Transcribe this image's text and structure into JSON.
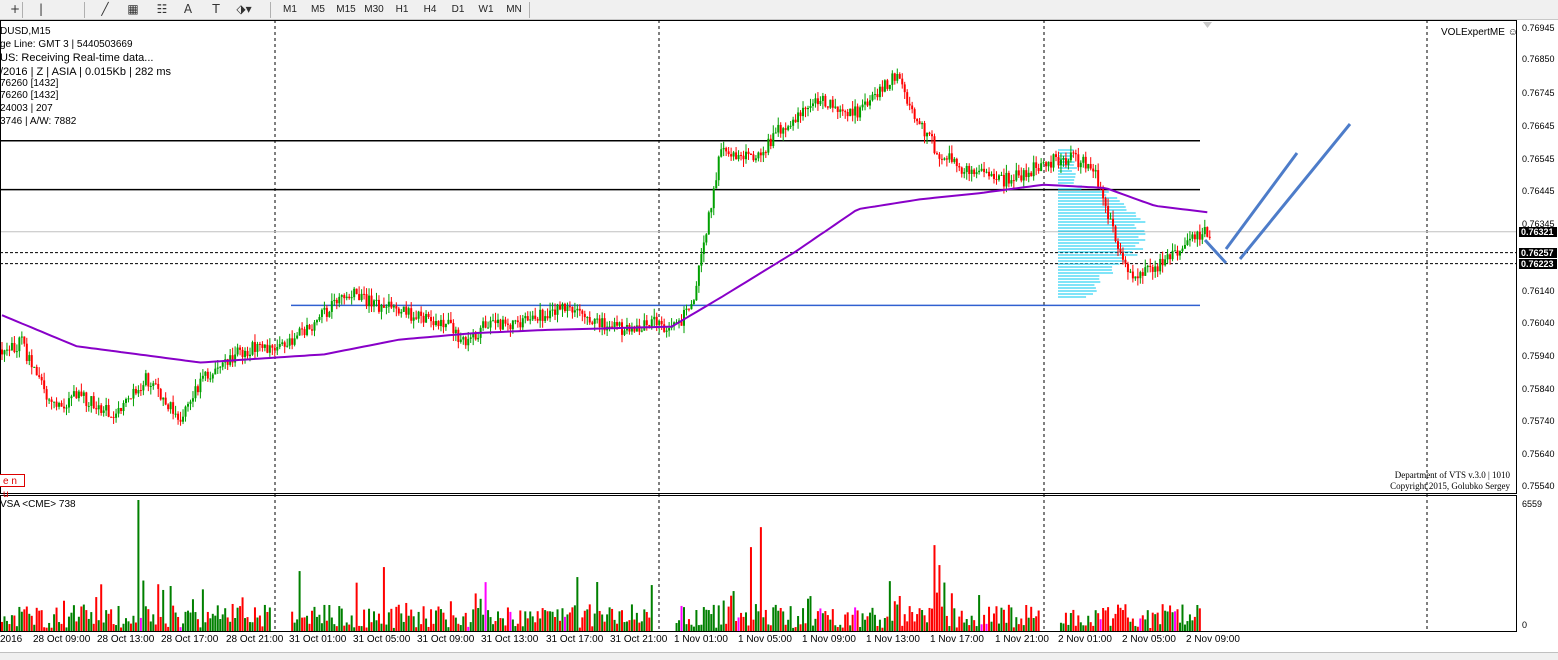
{
  "toolbar": {
    "tools": [
      {
        "name": "crosshair-icon",
        "glyph": "+"
      },
      {
        "name": "vertical-line-icon",
        "glyph": "|"
      },
      {
        "name": "trendline-icon",
        "glyph": "╱"
      },
      {
        "name": "fibonacci-icon",
        "glyph": "▦"
      },
      {
        "name": "gann-icon",
        "glyph": "☷"
      },
      {
        "name": "text-icon",
        "glyph": "A"
      },
      {
        "name": "text-label-icon",
        "glyph": "T"
      },
      {
        "name": "arrow-dropdown-icon",
        "glyph": "⬗▾"
      }
    ],
    "timeframes": [
      "M1",
      "M5",
      "M15",
      "M30",
      "H1",
      "H4",
      "D1",
      "W1",
      "MN"
    ]
  },
  "info_panel": {
    "lines": [
      "DUSD,M15",
      "ge Line: GMT 3  |  5440503669",
      "US:  Receiving Real-time data...",
      "/2016  |  Z  |  ASIA  |  0.015Kb  |  282 ms",
      "76260  [1432]",
      "76260  [1432]",
      "24003  |  207",
      "3746  |  A/W: 7882"
    ],
    "menu_tag": "e n u"
  },
  "expert": {
    "name": "VOLExpertME",
    "smiley": "☺"
  },
  "copyright": [
    "Department of VTS  v.3.0 | 1010",
    "Copyright 2015, Golubko Sergey"
  ],
  "indicator": {
    "label": "VSA <CME> 738",
    "max_label": "6559",
    "zero_label": "0"
  },
  "price_axis": {
    "labels": [
      "0.76945",
      "0.76850",
      "0.76745",
      "0.76645",
      "0.76545",
      "0.76445",
      "0.76345",
      "0.76140",
      "0.76040",
      "0.75940",
      "0.75840",
      "0.75740",
      "0.75640",
      "0.75540"
    ],
    "badges": [
      "0.76321",
      "0.76257",
      "0.76223"
    ]
  },
  "time_axis": {
    "labels": [
      "2016",
      "28 Oct 09:00",
      "28 Oct 13:00",
      "28 Oct 17:00",
      "28 Oct 21:00",
      "31 Oct 01:00",
      "31 Oct 05:00",
      "31 Oct 09:00",
      "31 Oct 13:00",
      "31 Oct 17:00",
      "31 Oct 21:00",
      "1 Nov 01:00",
      "1 Nov 05:00",
      "1 Nov 09:00",
      "1 Nov 13:00",
      "1 Nov 17:00",
      "1 Nov 21:00",
      "2 Nov 01:00",
      "2 Nov 05:00",
      "2 Nov 09:00"
    ]
  },
  "colors": {
    "bull": "#00a000",
    "bear": "#ff0000",
    "ma": "#8800c8",
    "hline": "#000000",
    "support": "#3060d0",
    "profile": "#00c8f0",
    "arrow": "#4d7cc9",
    "vol_green": "#008000",
    "vol_red": "#ff0000",
    "vol_magenta": "#ff00ff"
  },
  "chart_data": {
    "type": "candlestick",
    "symbol": "AUDUSD",
    "timeframe": "M15",
    "ylim": [
      0.7552,
      0.7697
    ],
    "anchors": [
      [
        0,
        0.7596
      ],
      [
        8,
        0.7598
      ],
      [
        20,
        0.7578
      ],
      [
        30,
        0.7582
      ],
      [
        45,
        0.7576
      ],
      [
        58,
        0.7587
      ],
      [
        72,
        0.7575
      ],
      [
        82,
        0.7588
      ],
      [
        96,
        0.7595
      ],
      [
        104,
        0.7598
      ],
      [
        110,
        0.7596
      ],
      [
        120,
        0.7601
      ],
      [
        130,
        0.7607
      ],
      [
        140,
        0.7613
      ],
      [
        150,
        0.761
      ],
      [
        165,
        0.7607
      ],
      [
        178,
        0.7605
      ],
      [
        185,
        0.7598
      ],
      [
        195,
        0.7603
      ],
      [
        210,
        0.7605
      ],
      [
        225,
        0.7608
      ],
      [
        235,
        0.7606
      ],
      [
        250,
        0.7602
      ],
      [
        262,
        0.7604
      ],
      [
        270,
        0.7603
      ],
      [
        278,
        0.7608
      ],
      [
        290,
        0.7657
      ],
      [
        305,
        0.7655
      ],
      [
        315,
        0.7665
      ],
      [
        330,
        0.7672
      ],
      [
        345,
        0.7668
      ],
      [
        360,
        0.768
      ],
      [
        370,
        0.7665
      ],
      [
        378,
        0.7656
      ],
      [
        390,
        0.765
      ],
      [
        405,
        0.7648
      ],
      [
        420,
        0.7653
      ],
      [
        430,
        0.7655
      ],
      [
        440,
        0.7652
      ],
      [
        448,
        0.7632
      ],
      [
        456,
        0.7617
      ],
      [
        470,
        0.7623
      ],
      [
        480,
        0.763
      ],
      [
        487,
        0.7632
      ]
    ],
    "moving_average": [
      [
        0,
        0.76065
      ],
      [
        30,
        0.7597
      ],
      [
        60,
        0.7594
      ],
      [
        80,
        0.7592
      ],
      [
        100,
        0.7593
      ],
      [
        130,
        0.75945
      ],
      [
        160,
        0.7599
      ],
      [
        190,
        0.7601
      ],
      [
        220,
        0.7602
      ],
      [
        270,
        0.7603
      ],
      [
        290,
        0.7612
      ],
      [
        320,
        0.7626
      ],
      [
        345,
        0.7639
      ],
      [
        370,
        0.7642
      ],
      [
        395,
        0.7644
      ],
      [
        420,
        0.76465
      ],
      [
        445,
        0.76455
      ],
      [
        465,
        0.764
      ],
      [
        487,
        0.7638
      ]
    ],
    "horizontal_levels": [
      0.766,
      0.7645,
      0.76095
    ],
    "dashed_levels": [
      0.76257,
      0.76223
    ],
    "current_price": 0.76321,
    "volume_max": 6559
  }
}
